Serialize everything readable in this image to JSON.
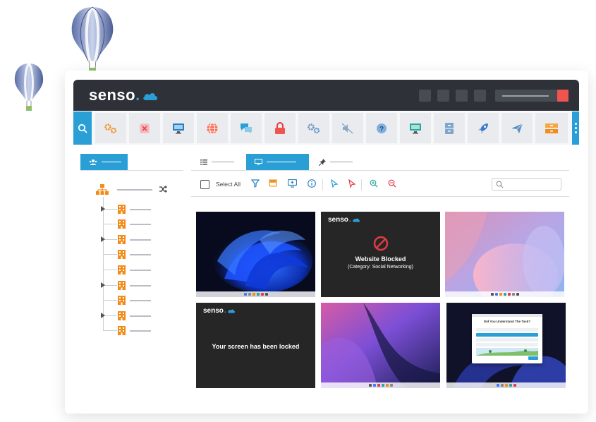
{
  "app": {
    "logo_text": "senso",
    "logo_dot": ".",
    "brand_color": "#2a9fd6",
    "header_color": "#2e3238",
    "accent_red": "#f0544f"
  },
  "toolbar": {
    "icons": [
      "search-icon",
      "gears-icon",
      "close-box-icon",
      "monitor-icon",
      "globe-icon",
      "chat-icon",
      "lock-icon",
      "settings-icon",
      "mute-icon",
      "help-icon",
      "screen-icon",
      "file-cabinet-icon",
      "rocket-icon",
      "send-icon",
      "drawer-icon"
    ]
  },
  "list": {
    "select_all": "Select All"
  },
  "tiles": {
    "blocked_title": "Website Blocked",
    "blocked_sub": "(Category: Social Networking)",
    "locked_title": "Your screen has been locked",
    "quiz_title": "Did You Understand The Task?"
  }
}
